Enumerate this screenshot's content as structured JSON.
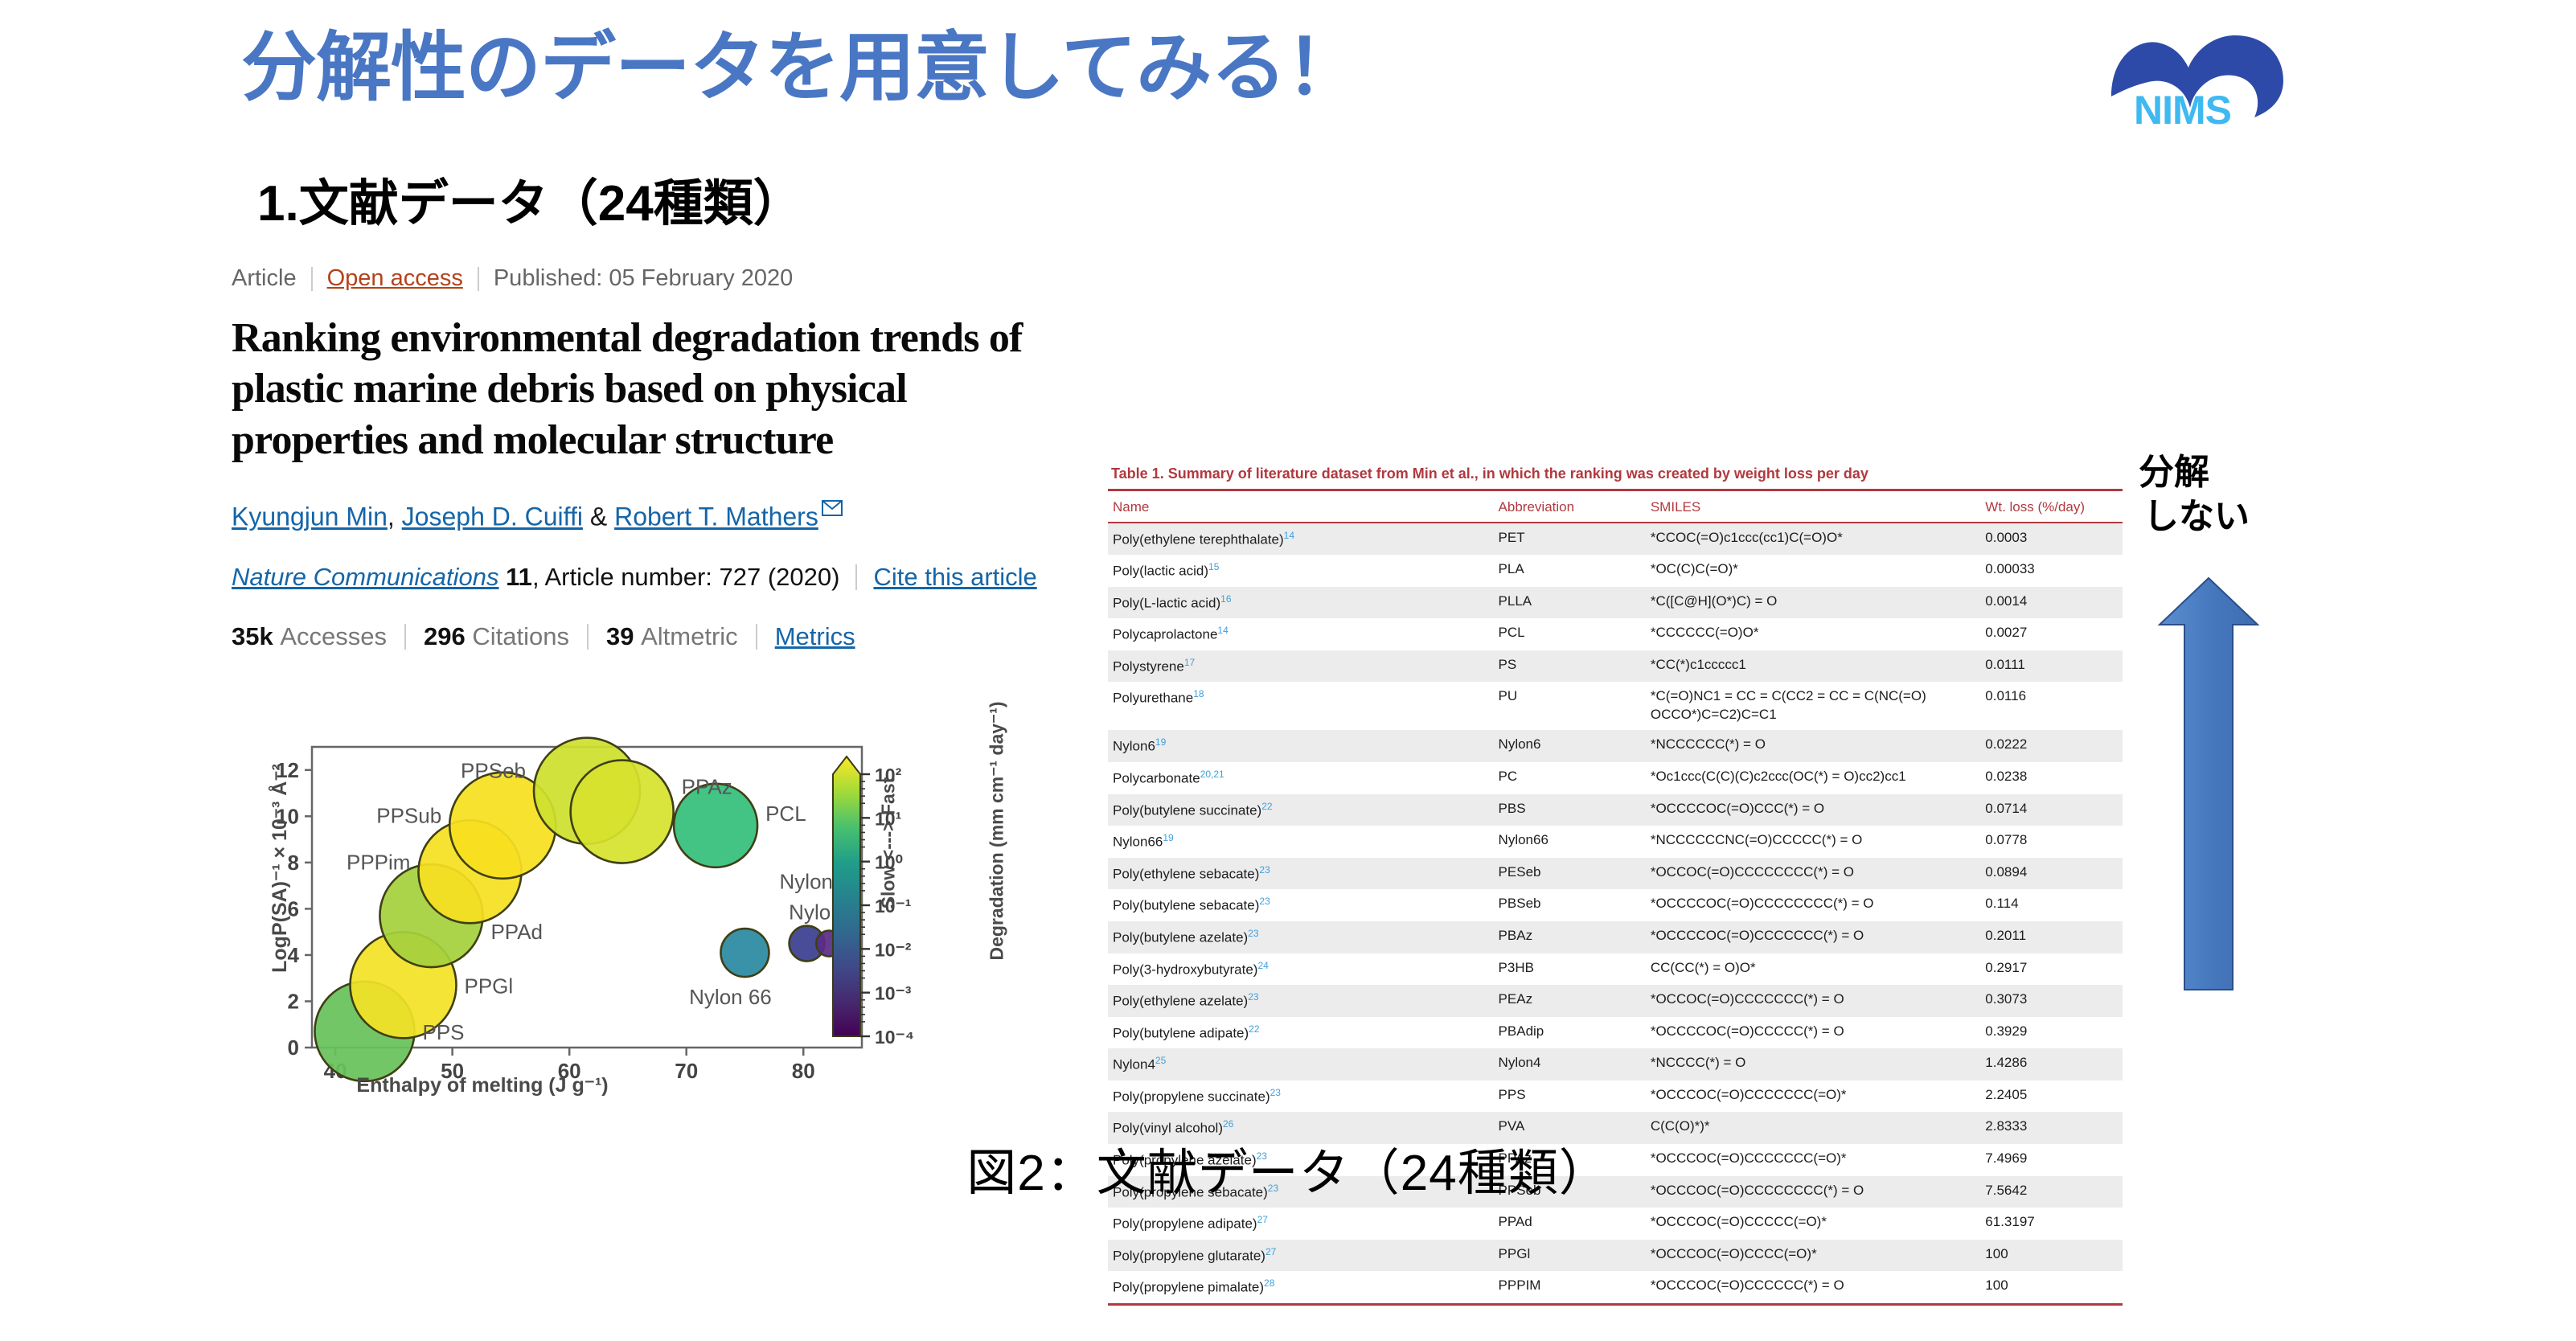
{
  "slide": {
    "title": "分解性のデータを用意してみる！",
    "section_heading": "1.文献データ（24種類）",
    "figure_caption": "図2：文献データ（24種類）",
    "title_color": "#4a77c4"
  },
  "logo": {
    "name": "nims-logo",
    "text": "NIMS",
    "mark_color": "#2e4aa8",
    "text_color": "#3fb9f0"
  },
  "article": {
    "type_label": "Article",
    "open_access_label": "Open access",
    "published_label": "Published: 05 February 2020",
    "title": "Ranking environmental degradation trends of plastic marine debris based on physical properties and molecular structure",
    "authors": [
      {
        "name": "Kyungjun Min",
        "sep": ", "
      },
      {
        "name": "Joseph D. Cuiffi",
        "sep": " & "
      },
      {
        "name": "Robert T. Mathers",
        "sep": ""
      }
    ],
    "mail_icon": "envelope-icon",
    "journal_name": "Nature Communications",
    "volume": "11",
    "article_number_text": ", Article number: 727 (2020)",
    "cite_label": "Cite this article",
    "metrics": [
      {
        "value": "35k",
        "label": "Accesses"
      },
      {
        "value": "296",
        "label": "Citations"
      },
      {
        "value": "39",
        "label": "Altmetric"
      }
    ],
    "metrics_link": "Metrics"
  },
  "table": {
    "caption": "Table 1.  Summary of literature dataset from Min et al., in which the ranking was created by weight loss per day",
    "accent_color": "#b0393f",
    "columns": [
      "Name",
      "Abbreviation",
      "SMILES",
      "Wt. loss (%/day)"
    ],
    "rows": [
      {
        "name": "Poly(ethylene terephthalate)",
        "ref": "14",
        "abbr": "PET",
        "smiles": "*CCOC(=O)c1ccc(cc1)C(=O)O*",
        "wt": "0.0003"
      },
      {
        "name": "Poly(lactic acid)",
        "ref": "15",
        "abbr": "PLA",
        "smiles": "*OC(C)C(=O)*",
        "wt": "0.00033"
      },
      {
        "name": "Poly(L-lactic acid)",
        "ref": "16",
        "abbr": "PLLA",
        "smiles": "*C([C@H](O*)C) = O",
        "wt": "0.0014"
      },
      {
        "name": "Polycaprolactone",
        "ref": "14",
        "abbr": "PCL",
        "smiles": "*CCCCCC(=O)O*",
        "wt": "0.0027"
      },
      {
        "name": "Polystyrene",
        "ref": "17",
        "abbr": "PS",
        "smiles": "*CC(*)c1ccccc1",
        "wt": "0.0111"
      },
      {
        "name": "Polyurethane",
        "ref": "18",
        "abbr": "PU",
        "smiles": "*C(=O)NC1 = CC = C(CC2 = CC = C(NC(=O) OCCO*)C=C2)C=C1",
        "wt": "0.0116"
      },
      {
        "name": "Nylon6",
        "ref": "19",
        "abbr": "Nylon6",
        "smiles": "*NCCCCCC(*) = O",
        "wt": "0.0222"
      },
      {
        "name": "Polycarbonate",
        "ref": "20,21",
        "abbr": "PC",
        "smiles": "*Oc1ccc(C(C)(C)c2ccc(OC(*) = O)cc2)cc1",
        "wt": "0.0238"
      },
      {
        "name": "Poly(butylene succinate)",
        "ref": "22",
        "abbr": "PBS",
        "smiles": "*OCCCCOC(=O)CCC(*) = O",
        "wt": "0.0714"
      },
      {
        "name": "Nylon66",
        "ref": "19",
        "abbr": "Nylon66",
        "smiles": "*NCCCCCCNC(=O)CCCCC(*) = O",
        "wt": "0.0778"
      },
      {
        "name": "Poly(ethylene sebacate)",
        "ref": "23",
        "abbr": "PESeb",
        "smiles": "*OCCOC(=O)CCCCCCCC(*) = O",
        "wt": "0.0894"
      },
      {
        "name": "Poly(butylene sebacate)",
        "ref": "23",
        "abbr": "PBSeb",
        "smiles": "*OCCCCOC(=O)CCCCCCCC(*) = O",
        "wt": "0.114"
      },
      {
        "name": "Poly(butylene azelate)",
        "ref": "23",
        "abbr": "PBAz",
        "smiles": "*OCCCCOC(=O)CCCCCCC(*) = O",
        "wt": "0.2011"
      },
      {
        "name": "Poly(3-hydroxybutyrate)",
        "ref": "24",
        "abbr": "P3HB",
        "smiles": "CC(CC(*) = O)O*",
        "wt": "0.2917"
      },
      {
        "name": "Poly(ethylene azelate)",
        "ref": "23",
        "abbr": "PEAz",
        "smiles": "*OCCOC(=O)CCCCCCC(*) = O",
        "wt": "0.3073"
      },
      {
        "name": "Poly(butylene adipate)",
        "ref": "22",
        "abbr": "PBAdip",
        "smiles": "*OCCCCOC(=O)CCCCC(*) = O",
        "wt": "0.3929"
      },
      {
        "name": "Nylon4",
        "ref": "25",
        "abbr": "Nylon4",
        "smiles": "*NCCCC(*) = O",
        "wt": "1.4286"
      },
      {
        "name": "Poly(propylene succinate)",
        "ref": "23",
        "abbr": "PPS",
        "smiles": "*OCCCOC(=O)CCCCCCC(=O)*",
        "wt": "2.2405"
      },
      {
        "name": "Poly(vinyl alcohol)",
        "ref": "26",
        "abbr": "PVA",
        "smiles": "C(C(O)*)*",
        "wt": "2.8333"
      },
      {
        "name": "Poly(propylene azelate)",
        "ref": "23",
        "abbr": "PPAz",
        "smiles": "*OCCCOC(=O)CCCCCCC(=O)*",
        "wt": "7.4969"
      },
      {
        "name": "Poly(propylene sebacate)",
        "ref": "23",
        "abbr": "PPSeb",
        "smiles": "*OCCCOC(=O)CCCCCCCC(*) = O",
        "wt": "7.5642"
      },
      {
        "name": "Poly(propylene adipate)",
        "ref": "27",
        "abbr": "PPAd",
        "smiles": "*OCCCOC(=O)CCCCC(=O)*",
        "wt": "61.3197"
      },
      {
        "name": "Poly(propylene glutarate)",
        "ref": "27",
        "abbr": "PPGl",
        "smiles": "*OCCCOC(=O)CCCC(=O)*",
        "wt": "100"
      },
      {
        "name": "Poly(propylene pimalate)",
        "ref": "28",
        "abbr": "PPPIM",
        "smiles": "*OCCCOC(=O)CCCCCC(*) = O",
        "wt": "100"
      }
    ]
  },
  "annotation": {
    "text_line1": "分解",
    "text_line2": "しない",
    "arrow_color": "#4a7ec0",
    "arrow_name": "up-arrow"
  },
  "chart_data": {
    "type": "scatter",
    "title": "",
    "xlabel": "Enthalpy of melting (J g⁻¹)",
    "ylabel": "LogP(SA)⁻¹ × 10⁻³ Å⁻²",
    "xlim": [
      38,
      85
    ],
    "ylim": [
      0,
      13
    ],
    "xticks": [
      40,
      50,
      60,
      70,
      80
    ],
    "yticks": [
      0,
      2,
      4,
      6,
      8,
      10,
      12
    ],
    "grid": false,
    "legend": "colorbar",
    "colorbar": {
      "label": "Degradation (mm cm⁻¹ day⁻¹)",
      "direction_label": "Slow <---> Fast",
      "scale": "log",
      "ticks": [
        "10²",
        "10¹",
        "10⁰",
        "10⁻¹",
        "10⁻²",
        "10⁻³",
        "10⁻⁴"
      ],
      "colormap": "viridis"
    },
    "points": [
      {
        "label": "PPS",
        "x": 42.5,
        "y": 0.7,
        "size": 62,
        "color": "#67c25a"
      },
      {
        "label": "PPGl",
        "x": 45.8,
        "y": 2.7,
        "size": 66,
        "color": "#f2e227"
      },
      {
        "label": "PPAd",
        "x": 48.2,
        "y": 5.7,
        "size": 64,
        "color": "#a5d13c"
      },
      {
        "label": "PPPim",
        "x": 51.5,
        "y": 7.6,
        "size": 64,
        "color": "#f5e021"
      },
      {
        "label": "PPSub",
        "x": 54.3,
        "y": 9.6,
        "size": 66,
        "color": "#f7e020"
      },
      {
        "label": "PPSeb",
        "x": 61.5,
        "y": 11.1,
        "size": 66,
        "color": "#cfe02e"
      },
      {
        "label": "PPAz",
        "x": 64.5,
        "y": 10.2,
        "size": 64,
        "color": "#d6e22d"
      },
      {
        "label": "PCL",
        "x": 72.5,
        "y": 9.6,
        "size": 52,
        "color": "#35c07c"
      },
      {
        "label": "Nylon 66",
        "x": 75.0,
        "y": 4.1,
        "size": 30,
        "color": "#2a8aa0"
      },
      {
        "label": "Nylon 6",
        "x": 80.3,
        "y": 4.5,
        "size": 22,
        "color": "#3b3e8f"
      },
      {
        "label": "Nylon 6",
        "x": 82.2,
        "y": 4.5,
        "size": 16,
        "color": "#5b2d87"
      }
    ]
  }
}
